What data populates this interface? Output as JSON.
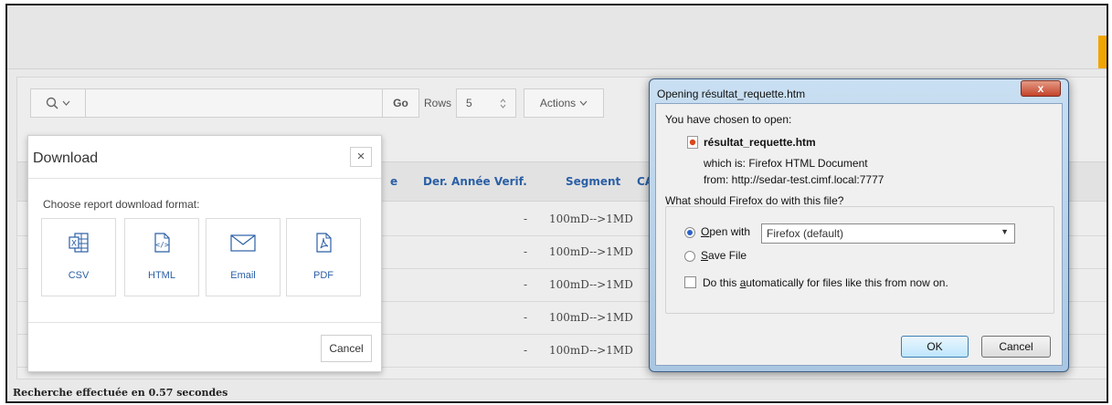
{
  "toolbar": {
    "go_label": "Go",
    "rows_label": "Rows",
    "rows_value": "5",
    "actions_label": "Actions"
  },
  "table": {
    "columns": [
      "Der. Année Verif.",
      "Segment",
      "CA"
    ],
    "rows": [
      {
        "annee": "-",
        "segment": "100mD-->1MD"
      },
      {
        "annee": "-",
        "segment": "100mD-->1MD"
      },
      {
        "annee": "-",
        "segment": "100mD-->1MD"
      },
      {
        "annee": "-",
        "segment": "100mD-->1MD"
      },
      {
        "annee": "-",
        "segment": "100mD-->1MD"
      }
    ]
  },
  "status": "Recherche effectuée en 0.57 secondes",
  "download": {
    "title": "Download",
    "subtitle": "Choose report download format:",
    "options": [
      {
        "label": "CSV",
        "icon": "csv-file-icon"
      },
      {
        "label": "HTML",
        "icon": "html-file-icon"
      },
      {
        "label": "Email",
        "icon": "envelope-icon"
      },
      {
        "label": "PDF",
        "icon": "pdf-file-icon"
      }
    ],
    "cancel_label": "Cancel"
  },
  "firefox": {
    "title": "Opening résultat_requette.htm",
    "close_label": "x",
    "intro": "You have chosen to open:",
    "filename": "résultat_requette.htm",
    "which_is": "which is:  Firefox HTML Document",
    "from": "from:  http://sedar-test.cimf.local:7777",
    "question": "What should Firefox do with this file?",
    "open_with_pre": "",
    "open_with_key": "O",
    "open_with_rest": "pen with",
    "open_with_value": "Firefox (default)",
    "save_key": "S",
    "save_rest": "ave File",
    "auto_pre": "Do this ",
    "auto_key": "a",
    "auto_rest": "utomatically for files like this from now on.",
    "ok_label": "OK",
    "cancel_label": "Cancel"
  },
  "colors": {
    "link": "#2b5fa5",
    "accent": "#f0a500"
  }
}
